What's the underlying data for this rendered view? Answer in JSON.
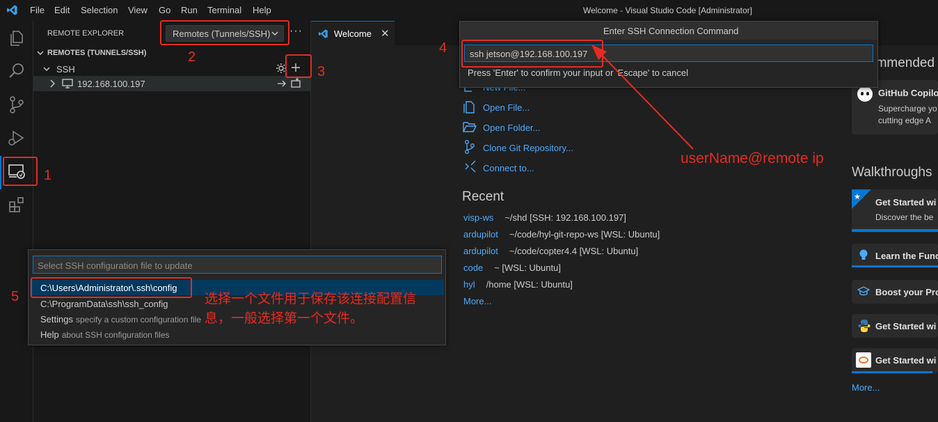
{
  "window": {
    "title": "Welcome - Visual Studio Code [Administrator]"
  },
  "menu": [
    "File",
    "Edit",
    "Selection",
    "View",
    "Go",
    "Run",
    "Terminal",
    "Help"
  ],
  "sidebar": {
    "header": "REMOTE EXPLORER",
    "dropdown": "Remotes (Tunnels/SSH)",
    "section": "REMOTES (TUNNELS/SSH)",
    "group": "SSH",
    "host": "192.168.100.197"
  },
  "tab": {
    "label": "Welcome"
  },
  "ssh_prompt": {
    "title": "Enter SSH Connection Command",
    "value": "ssh jetson@192.168.100.197",
    "hint": "Press 'Enter' to confirm your input or 'Escape' to cancel"
  },
  "start": {
    "items": [
      "New File...",
      "Open File...",
      "Open Folder...",
      "Clone Git Repository...",
      "Connect to..."
    ]
  },
  "recent": {
    "heading": "Recent",
    "items": [
      {
        "name": "visp-ws",
        "path": "~/shd [SSH: 192.168.100.197]"
      },
      {
        "name": "ardupilot",
        "path": "~/code/hyl-git-repo-ws [WSL: Ubuntu]"
      },
      {
        "name": "ardupilot",
        "path": "~/code/copter4.4 [WSL: Ubuntu]"
      },
      {
        "name": "code",
        "path": "~ [WSL: Ubuntu]"
      },
      {
        "name": "hyl",
        "path": "/home [WSL: Ubuntu]"
      }
    ],
    "more": "More..."
  },
  "right": {
    "recommended_heading": "ommended",
    "copilot_title": "GitHub Copilo",
    "copilot_desc1": "Supercharge yo",
    "copilot_desc2": "cutting edge A",
    "walkthroughs_heading": "Walkthroughs",
    "walk1_title": "Get Started wi",
    "walk1_desc": "Discover the be",
    "walk2": "Learn the Fund",
    "walk3": "Boost your Pro",
    "walk4": "Get Started wi",
    "walk5": "Get Started wi",
    "more": "More..."
  },
  "ssh_config_picker": {
    "placeholder": "Select SSH configuration file to update",
    "options": [
      {
        "label": "C:\\Users\\Administrator\\.ssh\\config",
        "desc": ""
      },
      {
        "label": "C:\\ProgramData\\ssh\\ssh_config",
        "desc": ""
      },
      {
        "label": "Settings",
        "desc": "specify a custom configuration file"
      },
      {
        "label": "Help",
        "desc": "about SSH configuration files"
      }
    ]
  },
  "annotations": {
    "n1": "1",
    "n2": "2",
    "n3": "3",
    "n4": "4",
    "n5": "5",
    "remote_hint": "userName@remote ip",
    "file_hint_line1": "选择一个文件用于保存该连接配置信",
    "file_hint_line2": "息，一般选择第一个文件。"
  },
  "colors": {
    "accent": "#0078d4",
    "annotation": "#e52b22",
    "link": "#4daafc"
  }
}
